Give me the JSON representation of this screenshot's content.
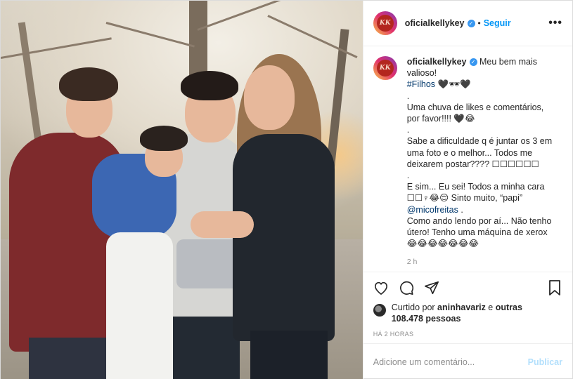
{
  "post": {
    "username": "oficialkellykey",
    "follow_label": "Seguir",
    "avatar_text": "KK",
    "more_icon": "more-horizontal-icon",
    "caption": {
      "username": "oficialkellykey",
      "first_line": "Meu bem mais valioso!",
      "hashtag": "#Filhos",
      "emoji_hearts": "🖤🕶🖤",
      "lines": [
        ".",
        "Uma chuva de likes e comentários, por favor!!!! 🖤😂",
        ".",
        "Sabe a dificuldade q é juntar os 3 em uma foto e o melhor... Todos me deixarem postar???? ☐☐☐☐☐☐",
        ".",
        "E sim... Eu sei! Todos a minha cara ☐☐♀😂😌 Sinto muito, “papi”"
      ],
      "mention": "@micofreitas",
      "mention_suffix": " .",
      "last_lines": "Como ando lendo por aí... Não tenho útero! Tenho uma máquina de xerox 😂😂😂😂😂😂😂",
      "time": "2 h"
    },
    "actions": {
      "like_icon": "heart-icon",
      "comment_icon": "comment-icon",
      "share_icon": "share-icon",
      "save_icon": "bookmark-icon"
    },
    "likes": {
      "prefix": "Curtido por ",
      "liker": "aninhavariz",
      "middle": " e ",
      "others": "outras 108.478 pessoas"
    },
    "posted_ago": "HÁ 2 HORAS",
    "comment": {
      "placeholder": "Adicione um comentário...",
      "publish_label": "Publicar"
    }
  },
  "colors": {
    "accent": "#0095f6",
    "publish_disabled": "#b2dffc",
    "muted": "#8e8e8e",
    "verified": "#3897f0"
  }
}
